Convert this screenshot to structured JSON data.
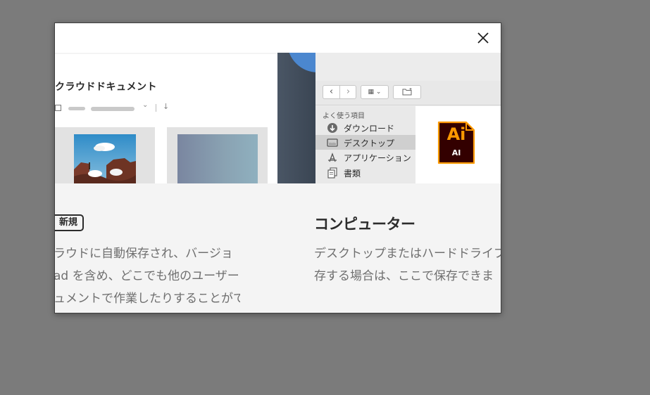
{
  "dialog": {
    "close_label": "×"
  },
  "cloud_illustration": {
    "title": "クラウドドキュメント",
    "chevron": "⌄",
    "download_arrow": "↓"
  },
  "finder": {
    "back": "‹",
    "forward": "›",
    "view_toggle": "▦ ⌄",
    "sidebar_heading": "よく使う項目",
    "sidebar_items": [
      {
        "label": "ダウンロード",
        "icon": "download-icon",
        "selected": false
      },
      {
        "label": "デスクトップ",
        "icon": "desktop-icon",
        "selected": true
      },
      {
        "label": "アプリケーション",
        "icon": "applications-icon",
        "selected": false
      },
      {
        "label": "書類",
        "icon": "documents-icon",
        "selected": false
      }
    ],
    "file": {
      "logo_text": "Ai",
      "label": "AI"
    }
  },
  "cloud_section": {
    "badge": "新規",
    "lines": [
      "ラウドに自動保存され、バージョ",
      "ad を含め、どこでも他のユーザー",
      "ュメントで作業したりすることがで"
    ]
  },
  "computer_section": {
    "title": "コンピューター",
    "lines": [
      "デスクトップまたはハードドライブに",
      "存する場合は、ここで保存できま"
    ]
  },
  "colors": {
    "backdrop": "#7b7b7b",
    "dialog_bg": "#f4f4f4",
    "ai_orange": "#ff9a00",
    "ai_bg": "#330000",
    "blue_accent": "#4b87cf"
  }
}
